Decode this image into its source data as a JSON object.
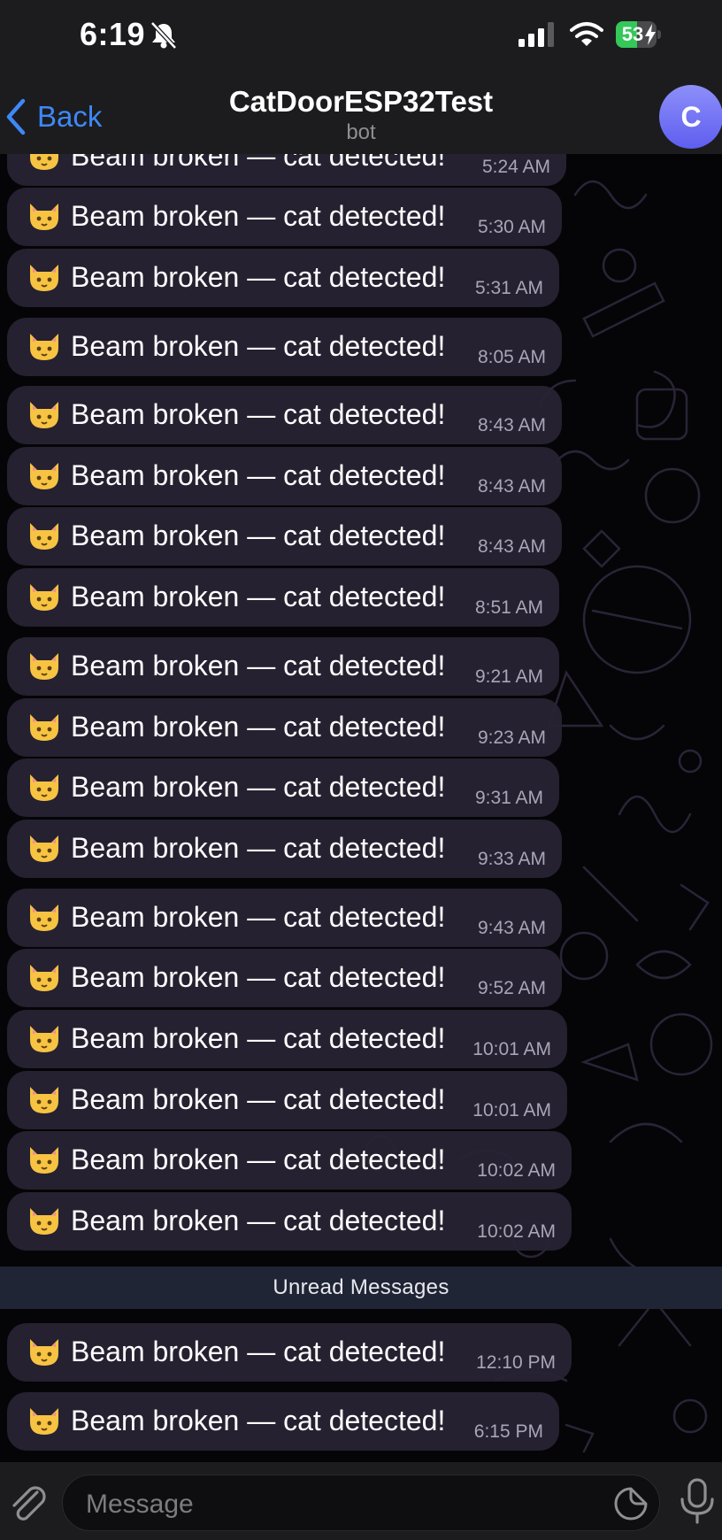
{
  "status_bar": {
    "time": "6:19",
    "battery": "53",
    "battery_level": 0.53,
    "bell_icon": "bell-slash-icon"
  },
  "header": {
    "back_label": "Back",
    "title": "CatDoorESP32Test",
    "subtitle": "bot",
    "avatar_letter": "C"
  },
  "messages_before": [
    {
      "text": "Beam broken — cat detected!",
      "time": "5:24 AM"
    },
    {
      "text": "Beam broken — cat detected!",
      "time": "5:30 AM"
    },
    {
      "text": "Beam broken — cat detected!",
      "time": "5:31 AM"
    },
    {
      "text": "Beam broken — cat detected!",
      "time": "8:05 AM"
    },
    {
      "text": "Beam broken — cat detected!",
      "time": "8:43 AM"
    },
    {
      "text": "Beam broken — cat detected!",
      "time": "8:43 AM"
    },
    {
      "text": "Beam broken — cat detected!",
      "time": "8:43 AM"
    },
    {
      "text": "Beam broken — cat detected!",
      "time": "8:51 AM"
    },
    {
      "text": "Beam broken — cat detected!",
      "time": "9:21 AM"
    },
    {
      "text": "Beam broken — cat detected!",
      "time": "9:23 AM"
    },
    {
      "text": "Beam broken — cat detected!",
      "time": "9:31 AM"
    },
    {
      "text": "Beam broken — cat detected!",
      "time": "9:33 AM"
    },
    {
      "text": "Beam broken — cat detected!",
      "time": "9:43 AM"
    },
    {
      "text": "Beam broken — cat detected!",
      "time": "9:52 AM"
    },
    {
      "text": "Beam broken — cat detected!",
      "time": "10:01 AM"
    },
    {
      "text": "Beam broken — cat detected!",
      "time": "10:01 AM"
    },
    {
      "text": "Beam broken — cat detected!",
      "time": "10:02 AM"
    },
    {
      "text": "Beam broken — cat detected!",
      "time": "10:02 AM"
    }
  ],
  "unread_divider": "Unread Messages",
  "messages_after": [
    {
      "text": "Beam broken — cat detected!",
      "time": "12:10 PM"
    },
    {
      "text": "Beam broken — cat detected!",
      "time": "6:15 PM"
    }
  ],
  "input_bar": {
    "placeholder": "Message"
  }
}
